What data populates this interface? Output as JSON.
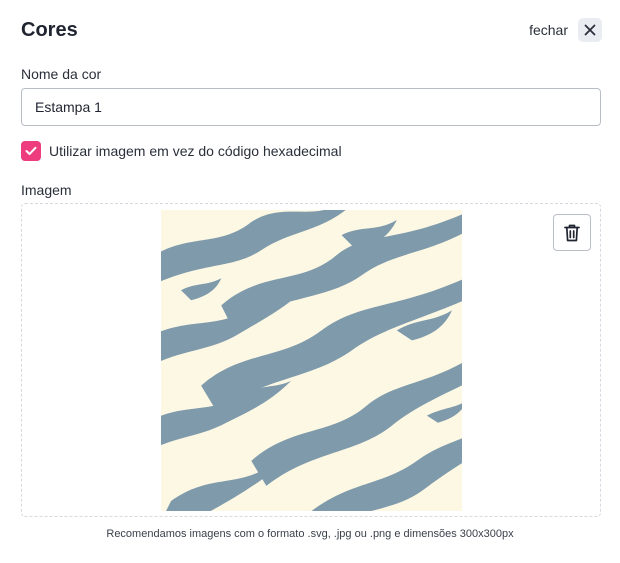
{
  "modal": {
    "title": "Cores",
    "close_label": "fechar",
    "close_icon": "close-icon"
  },
  "form": {
    "name_label": "Nome da cor",
    "name_value": "Estampa 1",
    "checkbox_label": "Utilizar imagem em vez do código hexadecimal",
    "checkbox_checked": true,
    "image_label": "Imagem",
    "delete_icon": "trash-icon",
    "hint": "Recomendamos imagens com o formato .svg, .jpg ou .png e dimensões 300x300px"
  },
  "colors": {
    "accent": "#ee3d7e",
    "pattern_background": "#fdf8e4",
    "pattern_stripes": "#7e9aab"
  }
}
